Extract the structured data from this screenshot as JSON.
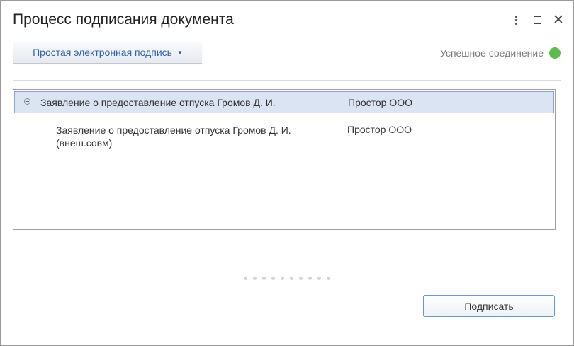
{
  "window": {
    "title": "Процесс подписания документа"
  },
  "toolbar": {
    "signature_type_label": "Простая электронная подпись",
    "connection_status": "Успешное соединение",
    "status_color": "#5fbb4d"
  },
  "documents": {
    "rows": [
      {
        "name": "Заявление о предоставление отпуска Громов Д. И.",
        "organization": "Простор ООО",
        "selected": true,
        "expanded": true
      },
      {
        "name": "Заявление о предоставление отпуска Громов Д. И. (внеш.совм)",
        "organization": "Простор ООО",
        "selected": false
      }
    ]
  },
  "footer": {
    "sign_label": "Подписать"
  }
}
